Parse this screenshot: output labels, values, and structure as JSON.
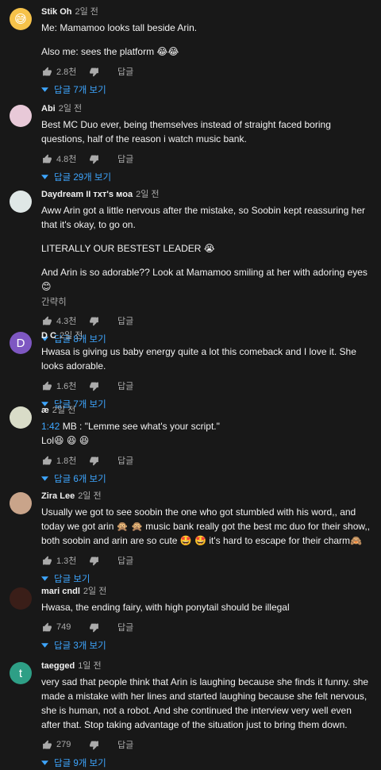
{
  "comments": [
    {
      "author": "Stik Oh",
      "time": "2일 전",
      "avatar_color": "#f6c24a",
      "avatar_text": "😅",
      "lines": [
        "Me: Mamamoo looks tall beside Arin.",
        "",
        "Also me: sees the platform 😂😂"
      ],
      "likes": "2.8천",
      "reply_label": "답글",
      "replies": "답글 7개 보기"
    },
    {
      "author": "Abi",
      "time": "2일 전",
      "avatar_color": "#e8c9d8",
      "avatar_text": "",
      "lines": [
        "Best MC Duo ever,  being themselves instead of straight faced boring questions, half of the reason i watch music bank."
      ],
      "likes": "4.8천",
      "reply_label": "답글",
      "replies": "답글 29개 보기"
    },
    {
      "author": "Daydream II ᴛxᴛ's ᴍoa",
      "time": "2일 전",
      "avatar_color": "#dfe7e6",
      "avatar_text": "",
      "lines": [
        "Aww Arin got a little nervous after the mistake, so Soobin kept reassuring her that it's okay, to go on.",
        "",
        "LITERALLY OUR BESTEST LEADER 😭",
        "",
        "And Arin is so adorable?? Look at Mamamoo smiling at her with adoring eyes 😊"
      ],
      "more": "간략히",
      "likes": "4.3천",
      "reply_label": "답글",
      "replies": "답글 8개 보기"
    },
    {
      "author": "D C",
      "time": "2일 전",
      "avatar_color": "#7e57c2",
      "avatar_text": "D",
      "lines": [
        "Hwasa is giving us baby energy quite a lot this comeback and I love it. She looks adorable."
      ],
      "likes": "1.6천",
      "reply_label": "답글",
      "replies": "답글 7개 보기"
    },
    {
      "author": "æ",
      "time": "2일 전",
      "avatar_color": "#d9dcc8",
      "avatar_text": "",
      "timestamp": "1:42",
      "lines": [
        " MB : \"Lemme see what's your script.\"",
        "Lol😆 😆 😆"
      ],
      "likes": "1.8천",
      "reply_label": "답글",
      "replies": "답글 6개 보기"
    },
    {
      "author": "Zira Lee",
      "time": "2일 전",
      "avatar_color": "#c9a48a",
      "avatar_text": "",
      "lines": [
        "Usually we got to see soobin the one who got stumbled with his word,, and today we got arin 🙊 🙊 music bank really got the best mc duo for their show,, both soobin and arin are so cute 🤩 🤩 it's hard to escape for their charm🙈"
      ],
      "likes": "1.3천",
      "reply_label": "답글",
      "replies": "답글 보기"
    },
    {
      "author": "mari cndl",
      "time": "2일 전",
      "avatar_color": "#3a1e18",
      "avatar_text": "",
      "lines": [
        "Hwasa, the ending fairy, with high ponytail should be illegal"
      ],
      "likes": "749",
      "reply_label": "답글",
      "replies": "답글 3개 보기"
    },
    {
      "author": "taegged",
      "time": "1일 전",
      "avatar_color": "#2e9f86",
      "avatar_text": "t",
      "lines": [
        "very sad that people think that Arin is laughing because she finds it funny.  she made a mistake with her lines and started laughing because she felt nervous, she is human, not a robot. And she continued the interview very well even after that. Stop taking advantage of the situation just to bring them down."
      ],
      "likes": "279",
      "reply_label": "답글",
      "replies": "답글 9개 보기"
    }
  ]
}
